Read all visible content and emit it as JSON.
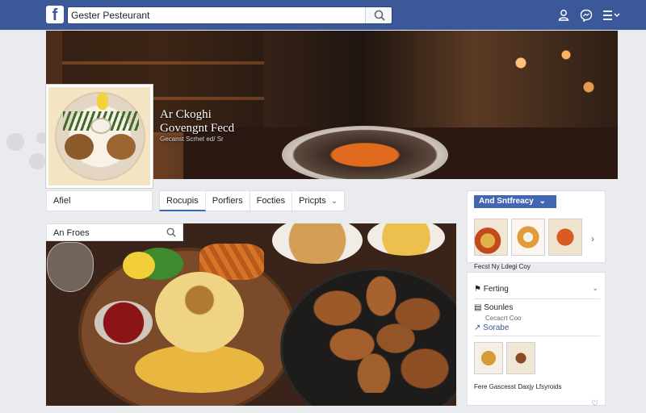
{
  "topbar": {
    "logo": "f",
    "search_value": "Gester Pesteurant",
    "icons": [
      "search-icon",
      "friends-icon",
      "messenger-icon",
      "menu-icon"
    ],
    "brand_color": "#3b5998"
  },
  "cover": {
    "title_line1": "Ar Ckoghi",
    "title_line2": "Govengnt Fecd",
    "subtitle": "Gecanst Scrhet ed/ Sr"
  },
  "left": {
    "about_label": "Afiel"
  },
  "tabs": [
    {
      "label": "Rocupis"
    },
    {
      "label": "Porfiers"
    },
    {
      "label": "Focties"
    },
    {
      "label": "Pricpts"
    }
  ],
  "photo_search": {
    "placeholder": "An Froes"
  },
  "right": {
    "follow_label": "And Sntfreacy",
    "caption": "Fecst",
    "caption2": "Ny Ldegi Coy",
    "section_title": "Ferting",
    "items": [
      {
        "label": "Sounles",
        "sub": "Cecacrt Coo"
      },
      {
        "label": "Sorabe",
        "sub": ""
      }
    ],
    "bottom_caption": "Fere Gascesst Daxjy Lfsyroids"
  }
}
